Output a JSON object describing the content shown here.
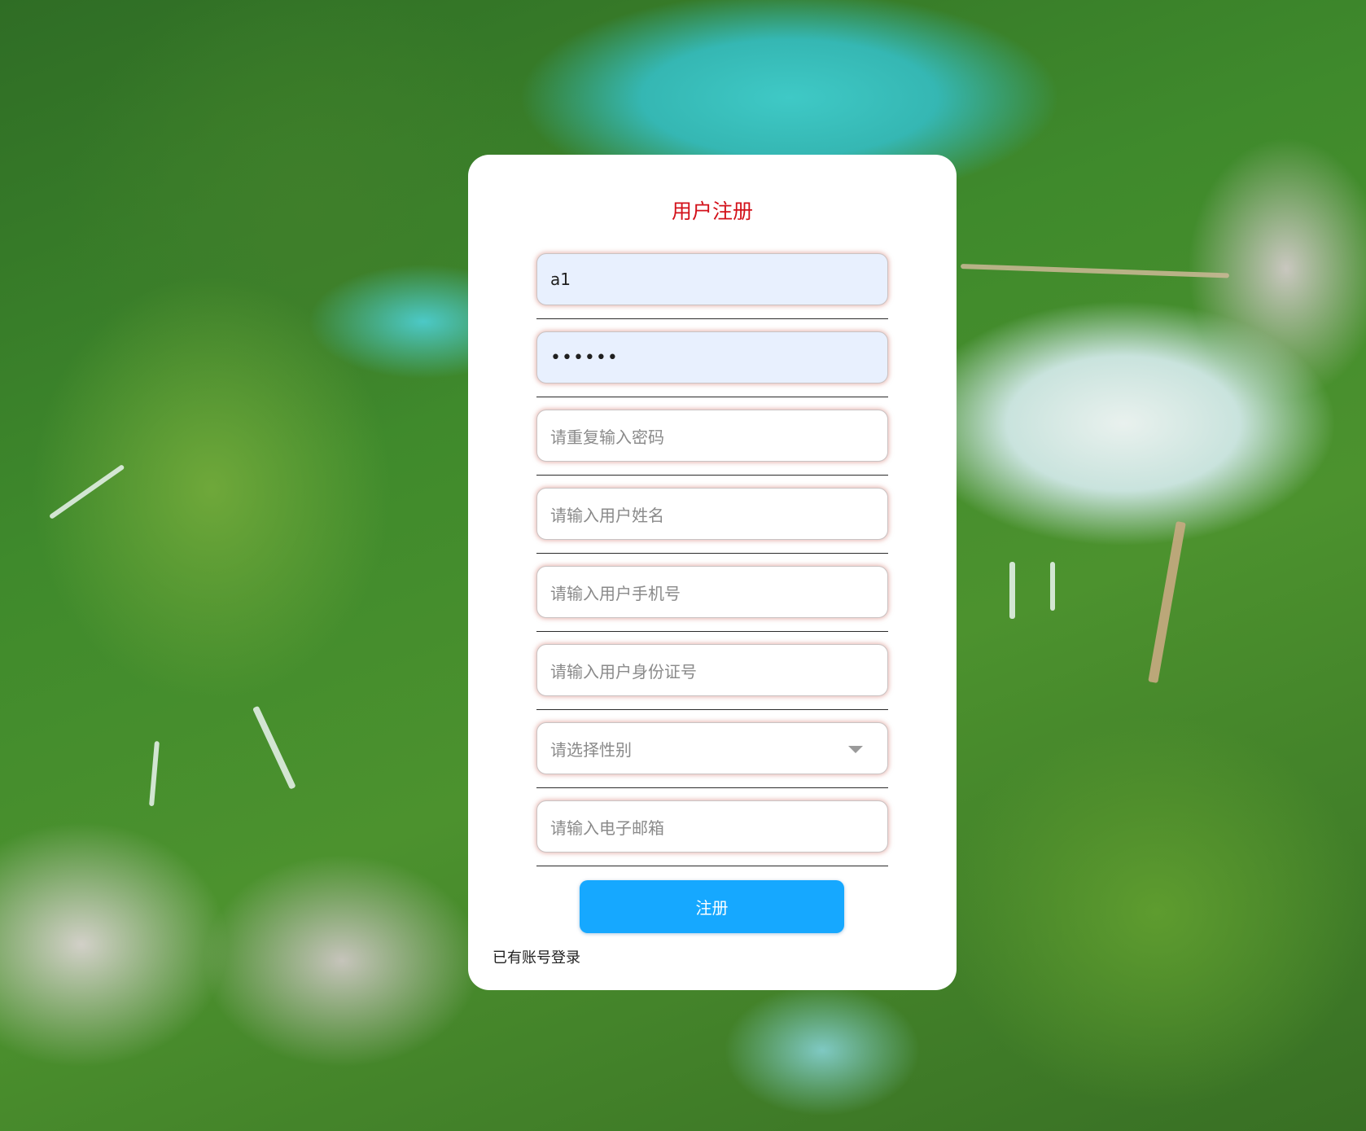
{
  "form": {
    "title": "用户注册",
    "username_value": "a1",
    "password_value": "••••••",
    "confirm_password_placeholder": "请重复输入密码",
    "name_placeholder": "请输入用户姓名",
    "phone_placeholder": "请输入用户手机号",
    "id_card_placeholder": "请输入用户身份证号",
    "gender_placeholder": "请选择性别",
    "email_placeholder": "请输入电子邮箱",
    "submit_label": "注册",
    "login_link": "已有账号登录"
  },
  "colors": {
    "title": "#d3121b",
    "submit_button": "#16a8ff",
    "filled_field_background": "#e8f0fe"
  },
  "icons": {
    "gender_dropdown": "chevron-down-icon"
  }
}
